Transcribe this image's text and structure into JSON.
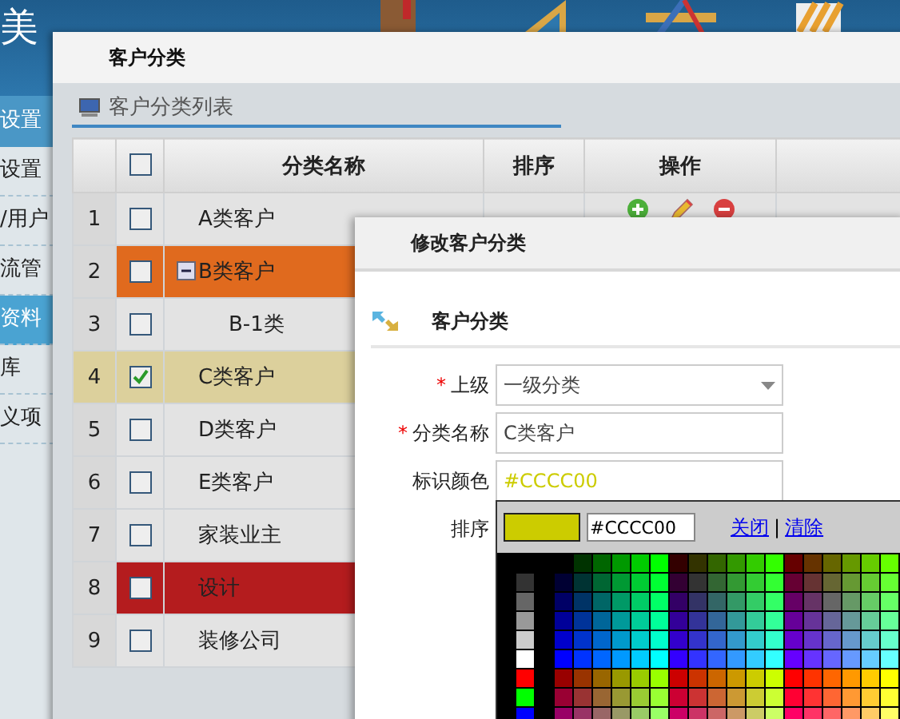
{
  "header": {
    "title": "美"
  },
  "sidebar": {
    "items": [
      {
        "label": "设置",
        "kind": "header",
        "selected": false
      },
      {
        "label": "设置",
        "kind": "item",
        "selected": false
      },
      {
        "label": "/用户",
        "kind": "item",
        "selected": false
      },
      {
        "label": "流管",
        "kind": "item",
        "selected": false
      },
      {
        "label": "资料",
        "kind": "item",
        "selected": true
      },
      {
        "label": "库",
        "kind": "item",
        "selected": false
      },
      {
        "label": "义项",
        "kind": "item",
        "selected": false
      }
    ]
  },
  "main_window": {
    "title": "客户分类",
    "tab": "客户分类列表",
    "table": {
      "select_all_checked": false,
      "columns": [
        "分类名称",
        "排序",
        "操作"
      ],
      "rows": [
        {
          "number": "1",
          "name": "A类客户",
          "checked": false,
          "actions": true
        },
        {
          "number": "2",
          "name": "B类客户",
          "checked": false,
          "color": "#e06a1e",
          "expanded": true,
          "children": [
            {
              "number": "3",
              "name": "B-1类",
              "checked": false
            }
          ]
        },
        {
          "number": "4",
          "name": "C类客户",
          "checked": true
        },
        {
          "number": "5",
          "name": "D类客户",
          "checked": false
        },
        {
          "number": "6",
          "name": "E类客户",
          "checked": false
        },
        {
          "number": "7",
          "name": "家装业主",
          "checked": false
        },
        {
          "number": "8",
          "name": "设计",
          "checked": false,
          "color": "#b41c1e"
        },
        {
          "number": "9",
          "name": "装修公司",
          "checked": false
        }
      ]
    }
  },
  "dialog": {
    "title": "修改客户分类",
    "section": "客户分类",
    "fields": [
      {
        "label": "上级",
        "marker": "*",
        "kind": "select",
        "value": "一级分类"
      },
      {
        "label": "分类名称",
        "marker": "*",
        "kind": "text",
        "value": "C类客户"
      },
      {
        "label": "标识颜色",
        "kind": "color",
        "value": "#CCCC00"
      },
      {
        "label": "排序",
        "kind": "text"
      }
    ]
  },
  "color_picker": {
    "color": "#cccc00",
    "hex": "#CCCC00",
    "links": [
      "关闭",
      "清除"
    ],
    "separator": "|"
  }
}
